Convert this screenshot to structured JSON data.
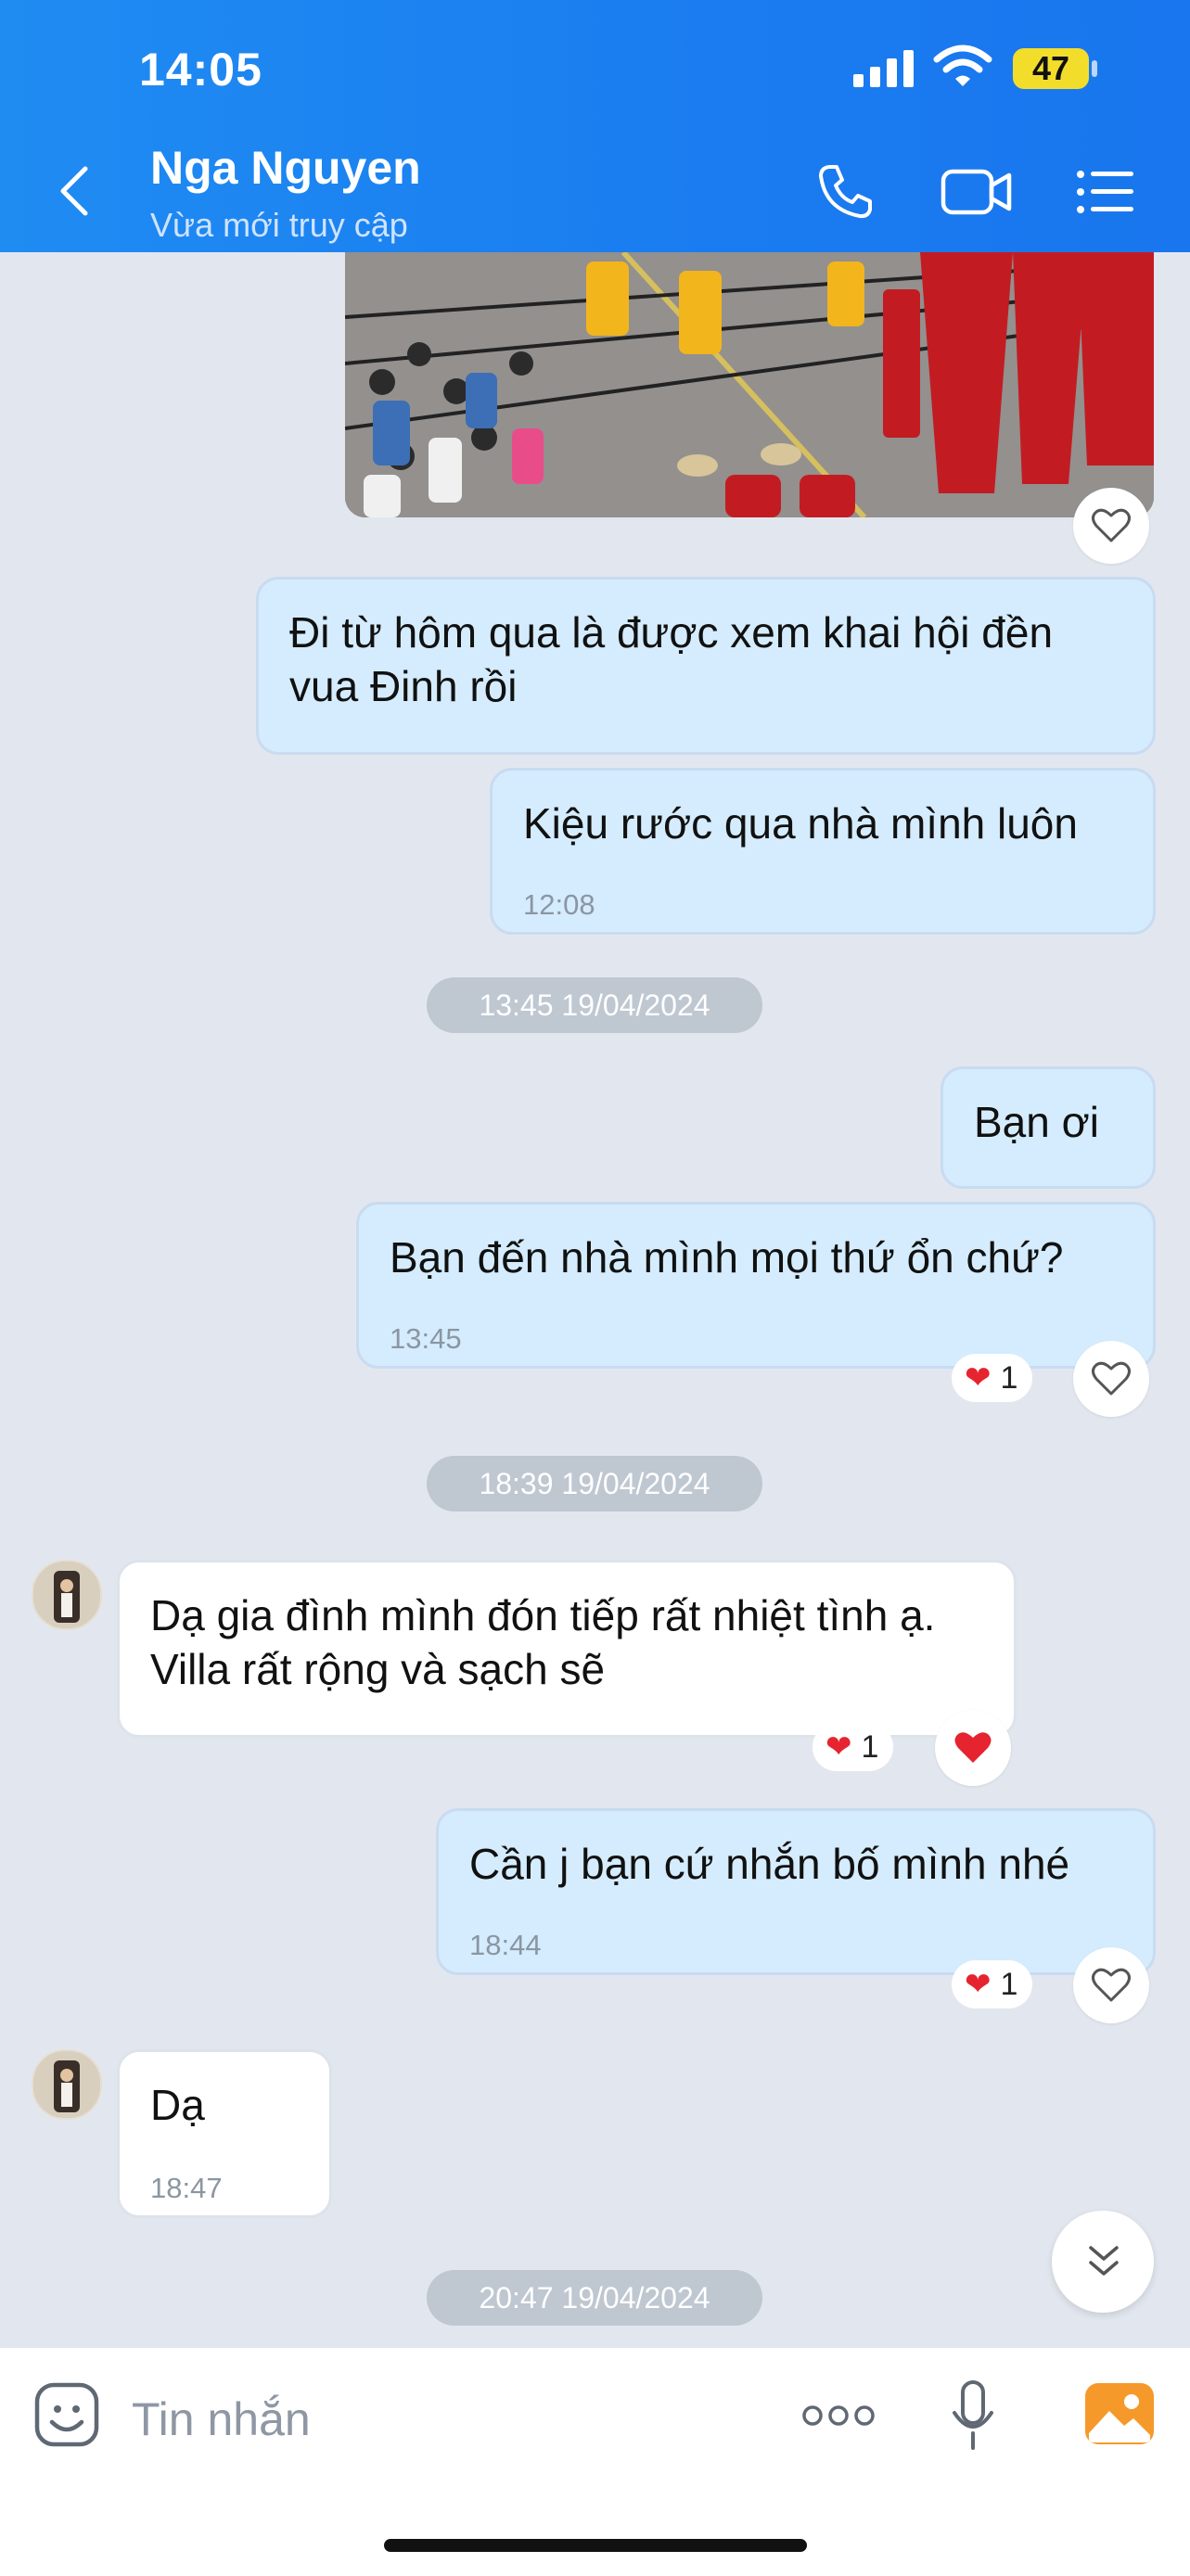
{
  "status_bar": {
    "time": "14:05",
    "battery": "47"
  },
  "header": {
    "contact_name": "Nga Nguyen",
    "status": "Vừa mới truy cập"
  },
  "messages": {
    "m1": {
      "text": "Đi từ hôm qua là được xem khai hội đền vua Đinh rồi"
    },
    "m2": {
      "text": "Kiệu rước qua nhà mình luôn",
      "time": "12:08"
    },
    "sep1": "13:45 19/04/2024",
    "m3": {
      "text": "Bạn ơi"
    },
    "m4": {
      "text": "Bạn đến nhà mình mọi thứ ổn chứ?",
      "time": "13:45",
      "reaction_count": "1"
    },
    "sep2": "18:39 19/04/2024",
    "m5": {
      "text": "Dạ gia đình mình đón tiếp rất nhiệt tình ạ. Villa rất rộng và sạch sẽ",
      "reaction_count": "1"
    },
    "m6": {
      "text": "Cần j bạn cứ nhắn bố mình nhé",
      "time": "18:44",
      "reaction_count": "1"
    },
    "m7": {
      "text": "Dạ",
      "time": "18:47"
    },
    "sep3": "20:47 19/04/2024"
  },
  "composer": {
    "placeholder": "Tin nhắn"
  },
  "colors": {
    "header": "#1a7cf0",
    "my_bubble": "#d4ecfd",
    "reaction_heart": "#e5242f"
  }
}
